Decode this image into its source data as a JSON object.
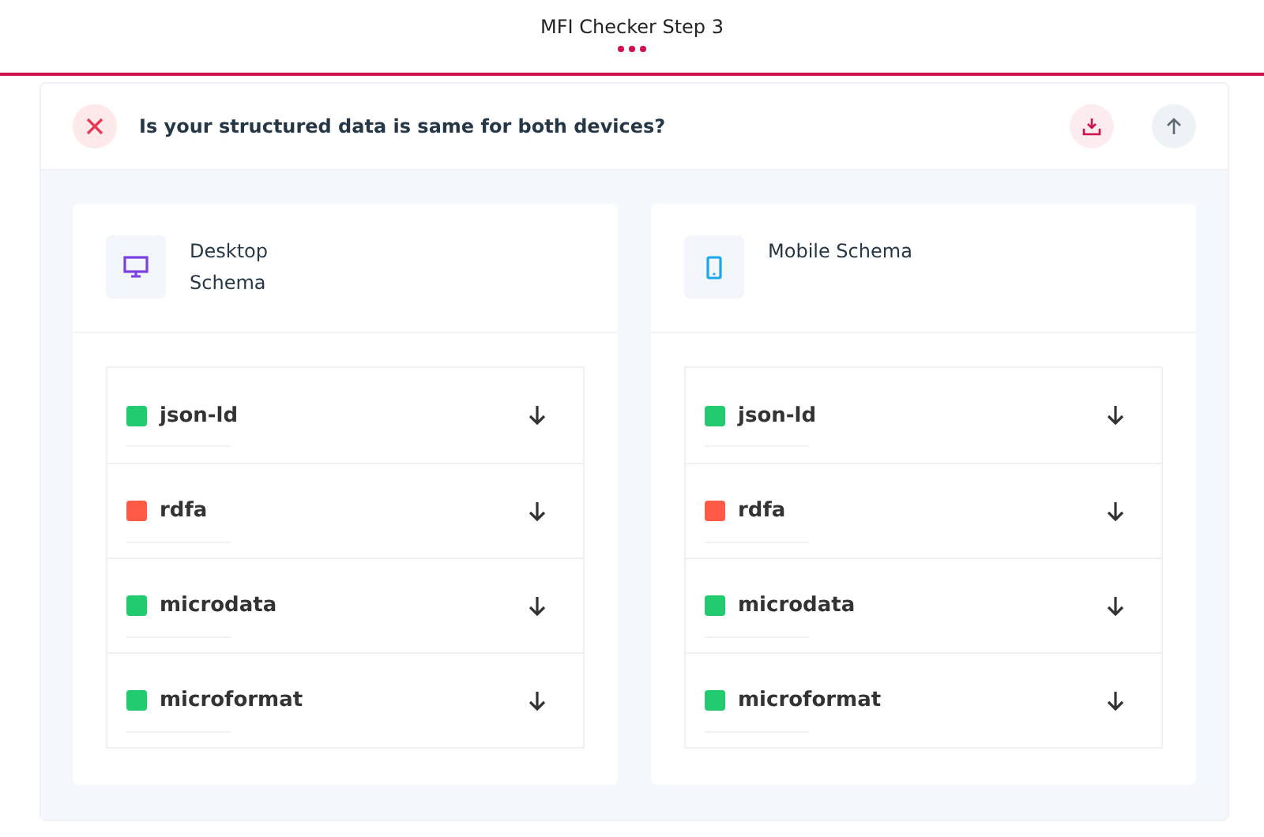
{
  "header": {
    "title": "MFI Checker Step 3"
  },
  "question": {
    "passed": false,
    "text": "Is your structured data is same for both devices?"
  },
  "panels": [
    {
      "kind": "desktop",
      "title": "Desktop Schema",
      "items": [
        {
          "name": "json-ld",
          "color": "#22cc6e"
        },
        {
          "name": "rdfa",
          "color": "#ff5a46"
        },
        {
          "name": "microdata",
          "color": "#22cc6e"
        },
        {
          "name": "microformat",
          "color": "#22cc6e"
        }
      ]
    },
    {
      "kind": "mobile",
      "title": "Mobile Schema",
      "items": [
        {
          "name": "json-ld",
          "color": "#22cc6e"
        },
        {
          "name": "rdfa",
          "color": "#ff5a46"
        },
        {
          "name": "microdata",
          "color": "#22cc6e"
        },
        {
          "name": "microformat",
          "color": "#22cc6e"
        }
      ]
    }
  ]
}
